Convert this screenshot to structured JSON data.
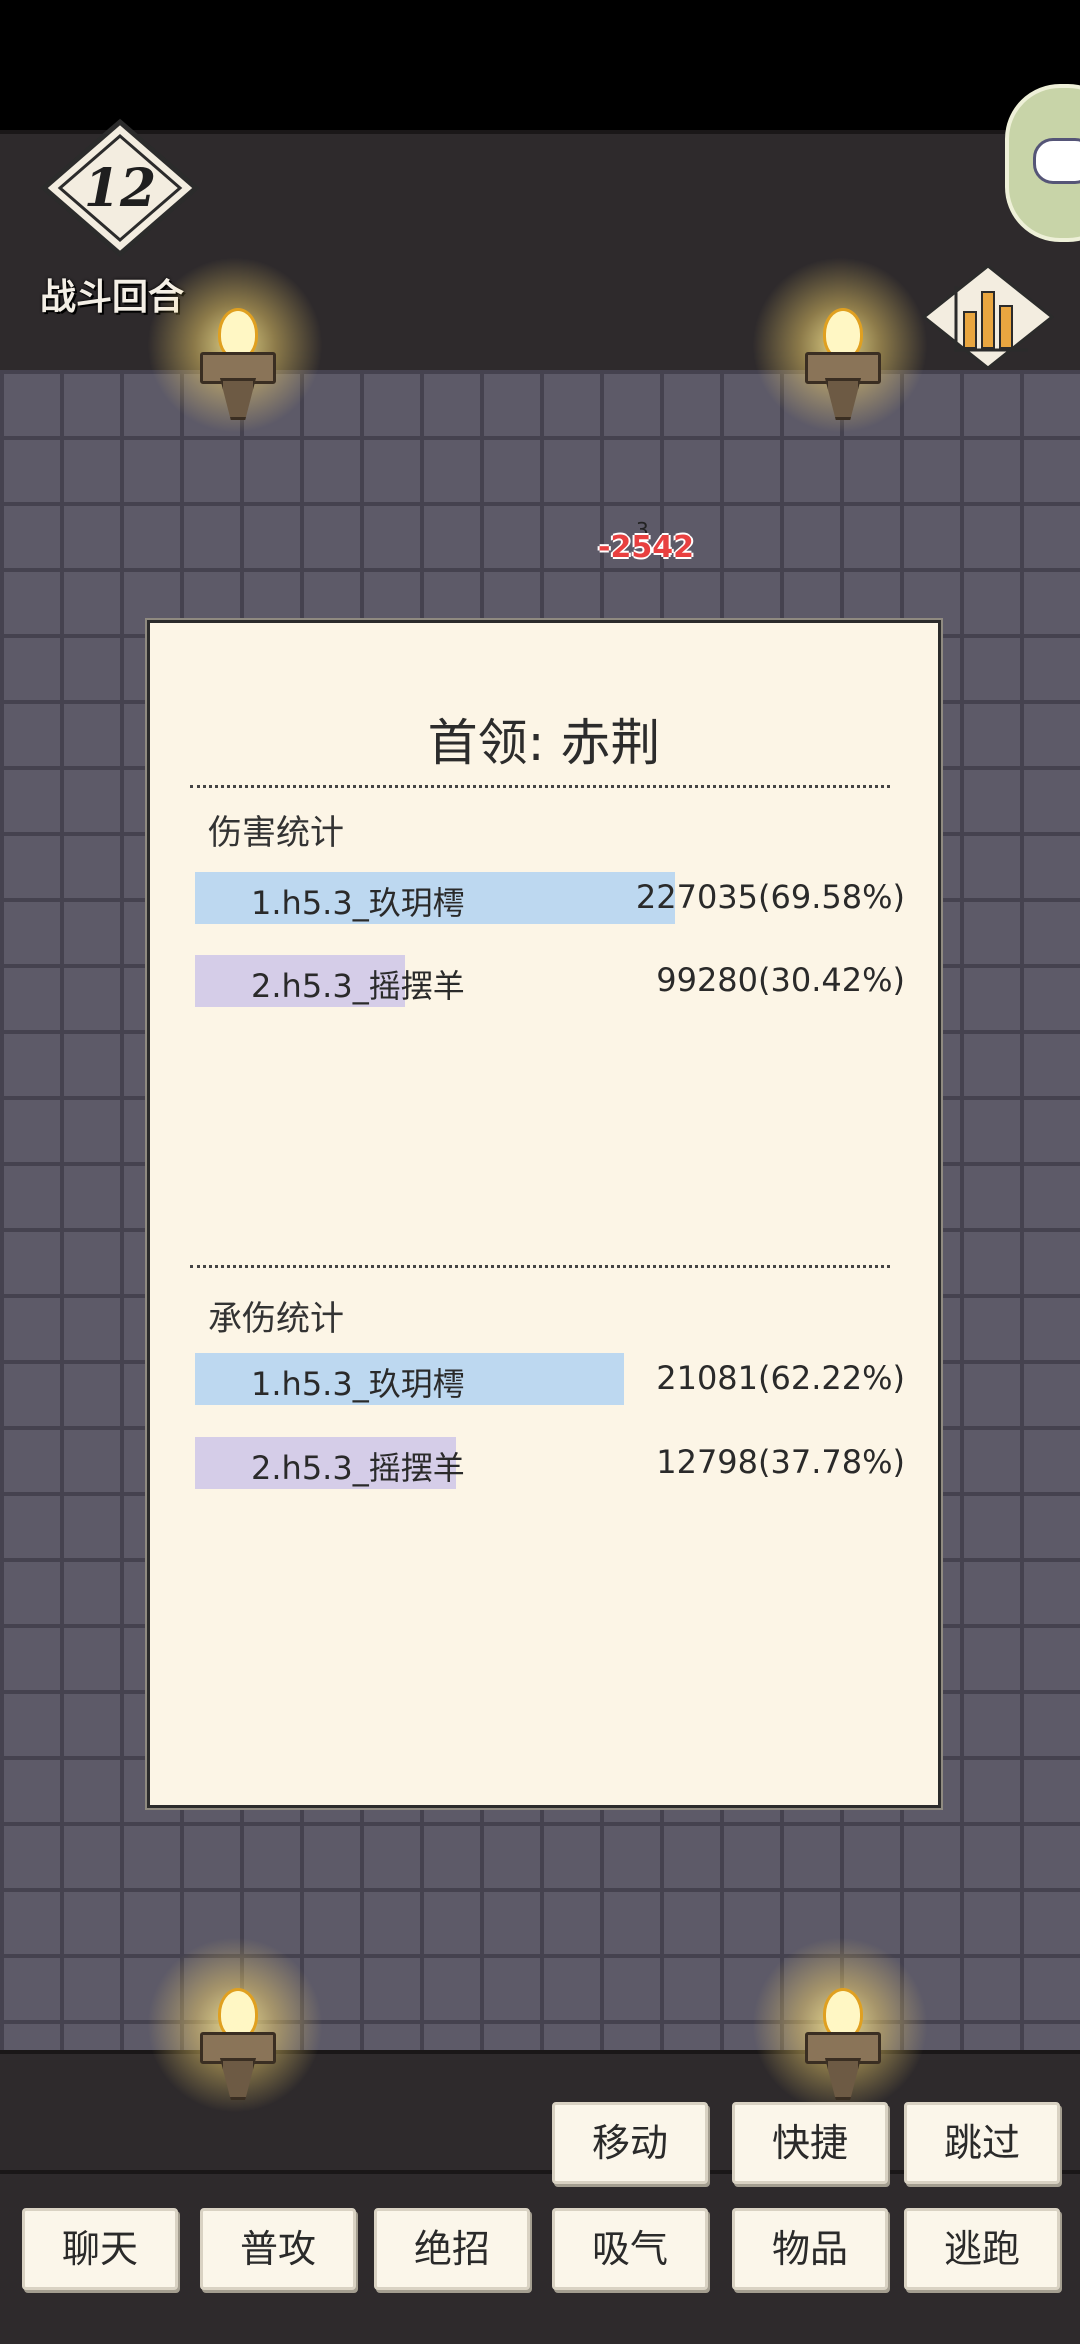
{
  "hud": {
    "round_number": "12",
    "round_label": "战斗回合",
    "floating_damage": "-2542",
    "floating_small": "3"
  },
  "panel": {
    "title": "首领: 赤荆",
    "damage_section": {
      "title": "伤害统计",
      "rows": [
        {
          "name": "1.h5.3_玖玥樗",
          "value": "227035(69.58%)",
          "percent": 69.58,
          "color": "#bdd8f0"
        },
        {
          "name": "2.h5.3_摇摆羊",
          "value": "99280(30.42%)",
          "percent": 30.42,
          "color": "#d5cde8"
        }
      ]
    },
    "tank_section": {
      "title": "承伤统计",
      "rows": [
        {
          "name": "1.h5.3_玖玥樗",
          "value": "21081(62.22%)",
          "percent": 62.22,
          "color": "#bdd8f0"
        },
        {
          "name": "2.h5.3_摇摆羊",
          "value": "12798(37.78%)",
          "percent": 37.78,
          "color": "#d5cde8"
        }
      ]
    }
  },
  "actions": {
    "move": "移动",
    "quick": "快捷",
    "skip": "跳过",
    "chat": "聊天",
    "attack": "普攻",
    "ultimate": "绝招",
    "absorb": "吸气",
    "items": "物品",
    "flee": "逃跑"
  },
  "icons": {
    "round_badge": "diamond-badge-icon",
    "torch": "torch-icon",
    "stats": "bar-chart-icon",
    "gamepad": "gamepad-icon"
  }
}
